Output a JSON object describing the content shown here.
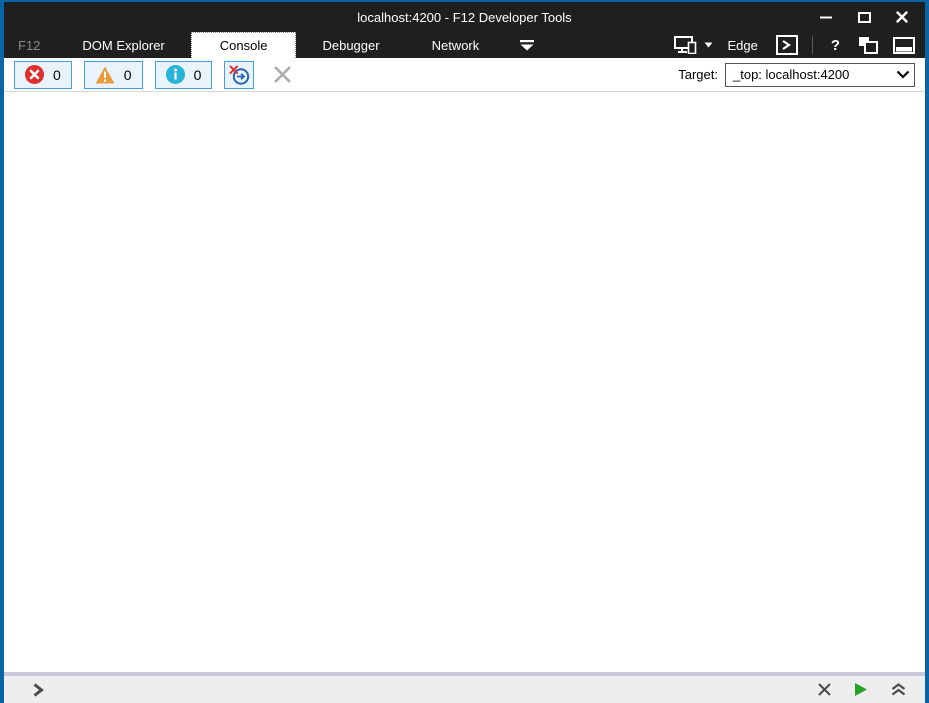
{
  "window": {
    "title": "localhost:4200 - F12 Developer Tools"
  },
  "tabs": {
    "f12_label": "F12",
    "items": [
      {
        "label": "DOM Explorer",
        "active": false
      },
      {
        "label": "Console",
        "active": true
      },
      {
        "label": "Debugger",
        "active": false
      },
      {
        "label": "Network",
        "active": false
      }
    ],
    "right": {
      "browser_label": "Edge",
      "help_label": "?"
    }
  },
  "toolbar": {
    "error_count": "0",
    "warning_count": "0",
    "info_count": "0",
    "target_label": "Target:",
    "target_value": "_top: localhost:4200"
  },
  "console": {
    "output": ""
  },
  "icons": {
    "titlebar": [
      "minimize-icon",
      "maximize-icon",
      "close-icon"
    ],
    "tabbar": [
      "tab-overflow-chevron-icon",
      "device-emulation-icon",
      "console-panel-icon",
      "pin-window-icon",
      "dock-bottom-icon"
    ],
    "toolbar": [
      "error-icon",
      "warning-icon",
      "info-icon",
      "clear-on-navigate-icon",
      "clear-console-icon",
      "select-chevron-icon"
    ],
    "prompt": [
      "prompt-chevron-icon",
      "clear-input-icon",
      "run-icon",
      "expand-multiline-icon"
    ]
  },
  "colors": {
    "window_border": "#0b65a4",
    "titlebar_bg": "#1f1f1f",
    "active_tab_bg": "#ffffff",
    "button_border": "#41a0e0",
    "button_bg": "#e9f3fc",
    "error_red": "#df2e2e",
    "warning_orange": "#e89c3c",
    "info_cyan": "#2ab3d9",
    "run_green": "#26a326",
    "prompt_bar_bg": "#eeeef0",
    "prompt_bar_border": "#c9cad7"
  }
}
